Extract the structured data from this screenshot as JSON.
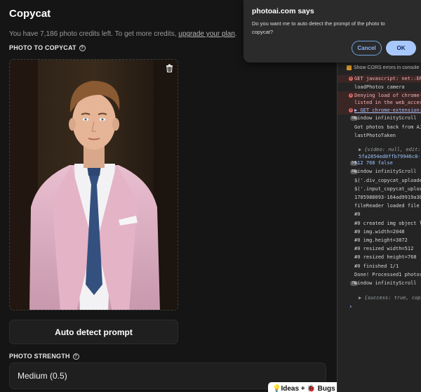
{
  "app": {
    "title": "Copycat",
    "credits_prefix": "You have 7,186 photo credits left. To get more credits, ",
    "upgrade_link": "upgrade your plan",
    "credits_suffix": ".",
    "photo_section_label": "PHOTO TO COPYCAT",
    "auto_detect_button": "Auto detect prompt",
    "strength_label": "PHOTO STRENGTH",
    "strength_value": "Medium (0.5)",
    "ideas_badge": "💡Ideas + 🐞 Bugs"
  },
  "dialog": {
    "title": "photoai.com says",
    "message": "Do you want me to auto detect the prompt of the photo to copycat?",
    "cancel_label": "Cancel",
    "ok_label": "OK"
  },
  "console": {
    "cors_label": "Show CORS errors in console",
    "lines": {
      "l1": "GET javascript: net::ERR_",
      "l2": "loadPhotos camera",
      "l3a": "Denying load of chrome-ex",
      "l3b": "listed in the web_accessi",
      "l4": "▶ GET chrome-extension://",
      "l5": "window infinityScroll",
      "l6": "Got photos back from AJAX",
      "l7": "lastPhotoTaken",
      "l8a": "▶ {video: null, edit: nul",
      "l8b": "5fa2854ed0ffb79946c8-I'",
      "l9": "512 768 false",
      "l10": "window infinityScroll",
      "l11": "$('.div_copycat_uploader'",
      "l12": "$('.input_copycat_uploade",
      "l13": "1705988093-164ad9919a3b0",
      "l14": "fileReader loaded file 0",
      "l15": "#0",
      "l16": "#0 created img object loa",
      "l17": "#0 img.width=2048",
      "l18": "#0 img.height=3072",
      "l19": "#0 resized width=512",
      "l20": "#0 resized height=768",
      "l21": "#0 finished 1/1",
      "l22": "Done! Processed1 photos o",
      "l23": "window infinityScroll",
      "l24": "▶ {success: true, copycat",
      "prompt": "›"
    },
    "counts": {
      "c1": "98",
      "c2": "54",
      "c3": "88",
      "c4": "78"
    }
  },
  "colors": {
    "background": "#151515",
    "dialog_ok": "#a8c7fa",
    "cors_checkbox": "#e09b2d",
    "error_bg": "#3b2626"
  }
}
